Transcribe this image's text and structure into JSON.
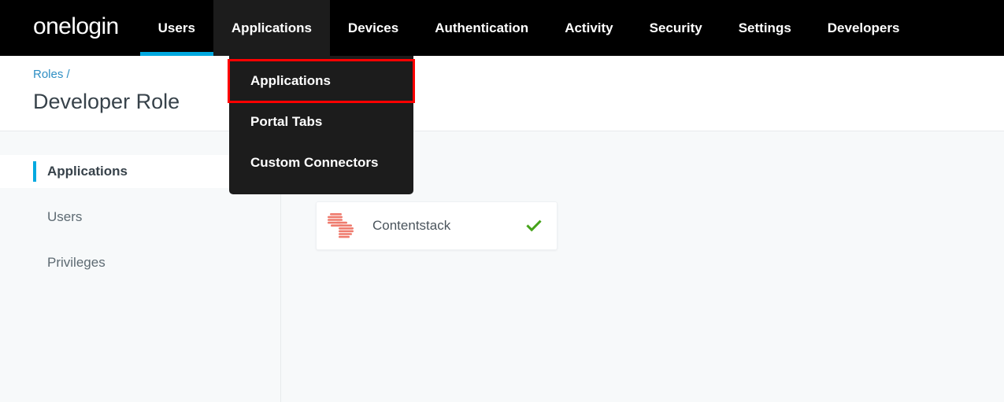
{
  "topnav": {
    "brand": "onelogin",
    "items": [
      {
        "label": "Users",
        "state": "active"
      },
      {
        "label": "Applications",
        "state": "hover"
      },
      {
        "label": "Devices",
        "state": "normal"
      },
      {
        "label": "Authentication",
        "state": "normal"
      },
      {
        "label": "Activity",
        "state": "normal"
      },
      {
        "label": "Security",
        "state": "normal"
      },
      {
        "label": "Settings",
        "state": "normal"
      },
      {
        "label": "Developers",
        "state": "normal"
      }
    ],
    "active_underline_color": "#00a9e0",
    "hover_background": "#1c1c1c",
    "background": "#000000"
  },
  "dropdown": {
    "open_for": "Applications",
    "background": "#1c1c1c",
    "highlight_color": "#ff0000",
    "items": [
      {
        "label": "Applications",
        "highlighted": true
      },
      {
        "label": "Portal Tabs",
        "highlighted": false
      },
      {
        "label": "Custom Connectors",
        "highlighted": false
      }
    ]
  },
  "header": {
    "breadcrumb": "Roles /",
    "breadcrumb_color": "#2f8fc4",
    "title": "Developer Role",
    "title_color": "#37424a"
  },
  "sidebar": {
    "items": [
      {
        "label": "Applications",
        "active": true
      },
      {
        "label": "Users",
        "active": false
      },
      {
        "label": "Privileges",
        "active": false
      }
    ],
    "active_marker_color": "#00a9e0"
  },
  "main": {
    "background": "#f7f9fa",
    "apps": [
      {
        "name": "Contentstack",
        "icon": "contentstack-logo-icon",
        "icon_color": "#ef7b6e",
        "status_icon": "check-icon",
        "status_color": "#46a31a",
        "selected": true
      }
    ]
  }
}
